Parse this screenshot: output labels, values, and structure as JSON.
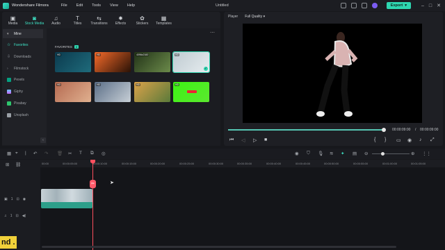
{
  "titlebar": {
    "app_name": "Wondershare Filmora",
    "menus": [
      "File",
      "Edit",
      "Tools",
      "View",
      "Help"
    ],
    "document_title": "Untitled",
    "export_label": "Export"
  },
  "media_tabs": [
    {
      "label": "Media",
      "icon": "media-icon"
    },
    {
      "label": "Stock Media",
      "icon": "stock-media-icon",
      "active": true
    },
    {
      "label": "Audio",
      "icon": "music-note-icon"
    },
    {
      "label": "Titles",
      "icon": "text-t-icon"
    },
    {
      "label": "Transitions",
      "icon": "transitions-icon"
    },
    {
      "label": "Effects",
      "icon": "effects-icon"
    },
    {
      "label": "Stickers",
      "icon": "stickers-icon"
    },
    {
      "label": "Templates",
      "icon": "templates-icon"
    }
  ],
  "sidebar": {
    "mine_label": "Mine",
    "items": [
      "Favorites",
      "Downloads",
      "Filmstock",
      "Pexels",
      "Giphy",
      "Pixabay",
      "Unsplash"
    ]
  },
  "favorites": {
    "label": "FAVORITES",
    "count": "8",
    "thumbnails": [
      {
        "tag": "HD",
        "colors": [
          "#0b3a4e",
          "#1f6b7b"
        ]
      },
      {
        "tag": "HD",
        "colors": [
          "#f56a2a",
          "#2a1206"
        ]
      },
      {
        "tag": "4096x2160",
        "colors": [
          "#223318",
          "#6b8a4a"
        ]
      },
      {
        "tag": "HD",
        "colors": [
          "#bfcbd1",
          "#e6ecef"
        ],
        "selected": true
      },
      {
        "tag": "HD",
        "colors": [
          "#b56a51",
          "#e0b08f"
        ]
      },
      {
        "tag": "HD",
        "colors": [
          "#5c6f88",
          "#c7cfd6"
        ]
      },
      {
        "tag": "HD",
        "colors": [
          "#dba24a",
          "#5a7a3a"
        ]
      },
      {
        "tag": "HD",
        "colors": [
          "#3df214",
          "#5be82f"
        ]
      }
    ]
  },
  "player": {
    "label": "Player",
    "quality": "Full Quality",
    "current_time": "00:00:09:00",
    "total_time": "00:00:09:00",
    "progress": 1.0
  },
  "timeline": {
    "ruler_ticks": [
      "00:00",
      "00:00:05:00",
      "00:00:10:00",
      "00:00:15:00",
      "00:00:20:00",
      "00:00:25:00",
      "00:00:30:00",
      "00:00:35:00",
      "00:00:40:00",
      "00:00:45:00",
      "00:00:50:00",
      "00:00:55:00",
      "00:01:00:00",
      "00:01:05:00"
    ],
    "video_track_label": "1",
    "audio_track_label": "1"
  },
  "caption": "nd ."
}
